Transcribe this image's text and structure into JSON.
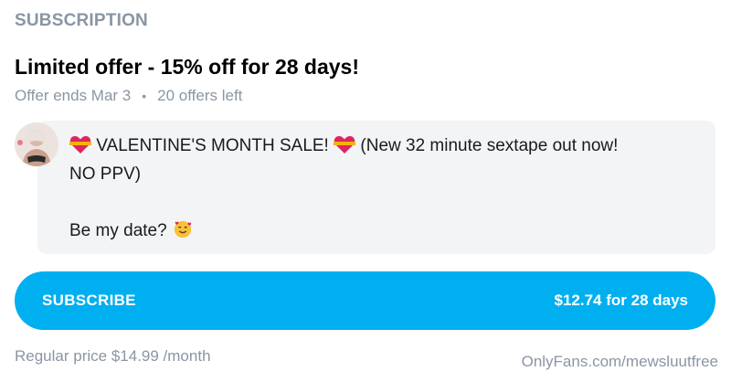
{
  "subscription": {
    "section_title": "SUBSCRIPTION",
    "offer_title": "Limited offer - 15% off for 28 days!",
    "offer_ends": "Offer ends Mar 3",
    "separator": "•",
    "offers_left": "20 offers left"
  },
  "message": {
    "line1_part1": "VALENTINE'S MONTH SALE!",
    "line1_part2": "(New 32 minute sextape out now!",
    "line2": "NO PPV)",
    "line3": "Be my date?"
  },
  "subscribe_button": {
    "label": "SUBSCRIBE",
    "price": "$12.74 for 28 days"
  },
  "footer": {
    "regular_price": "Regular price $14.99 /month",
    "watermark": "OnlyFans.com/mewsluutfree"
  },
  "colors": {
    "accent": "#00aff0",
    "muted_text": "#8a96a3",
    "message_bg": "#f2f4f6"
  },
  "icons": {
    "heart": "heart-ribbon-icon",
    "face": "smiling-face-with-hearts-icon",
    "avatar": "avatar"
  }
}
